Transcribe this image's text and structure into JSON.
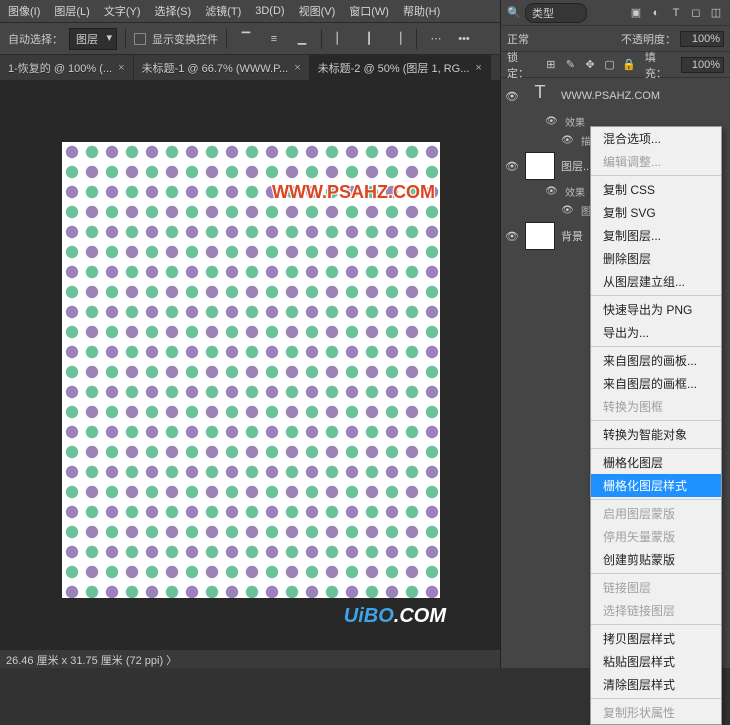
{
  "menu": [
    "图像(I)",
    "图层(L)",
    "文字(Y)",
    "选择(S)",
    "滤镜(T)",
    "3D(D)",
    "视图(V)",
    "窗口(W)",
    "帮助(H)"
  ],
  "toolbar": {
    "auto_select": "自动选择：",
    "layer_dd": "图层",
    "show_transform": "显示变换控件"
  },
  "tabs": [
    {
      "label": "1-恢复的 @ 100% (...",
      "active": false
    },
    {
      "label": "未标题-1 @ 66.7% (WWW.P...",
      "active": false
    },
    {
      "label": "未标题-2 @ 50% (图层 1, RG...",
      "active": true
    }
  ],
  "canvas": {
    "watermark": "WWW.PSAHZ.COM",
    "brand": "UiBO"
  },
  "status": "26.46 厘米 x 31.75 厘米 (72 ppi)  〉",
  "panel": {
    "search_prefix": "类型",
    "blend": "正常",
    "opacity_label": "不透明度：",
    "opacity_val": "100%",
    "lock_label": "锁定：",
    "fill_label": "填充：",
    "fill_val": "100%",
    "layers": [
      {
        "type": "text",
        "name": "WWW.PSAHZ.COM"
      },
      {
        "type": "fx",
        "name": "效果"
      },
      {
        "type": "sub",
        "name": "描..."
      },
      {
        "type": "normal",
        "name": "图层..."
      },
      {
        "type": "fx",
        "name": "效果"
      },
      {
        "type": "sub",
        "name": "图..."
      },
      {
        "type": "normal",
        "name": "背景"
      }
    ]
  },
  "ctx": {
    "items": [
      {
        "t": "混合选项...",
        "d": false
      },
      {
        "t": "编辑调整...",
        "d": true
      },
      {
        "sep": true
      },
      {
        "t": "复制 CSS",
        "d": false
      },
      {
        "t": "复制 SVG",
        "d": false
      },
      {
        "t": "复制图层...",
        "d": false
      },
      {
        "t": "删除图层",
        "d": false
      },
      {
        "t": "从图层建立组...",
        "d": false
      },
      {
        "sep": true
      },
      {
        "t": "快速导出为 PNG",
        "d": false
      },
      {
        "t": "导出为...",
        "d": false
      },
      {
        "sep": true
      },
      {
        "t": "来自图层的画板...",
        "d": false
      },
      {
        "t": "来自图层的画框...",
        "d": false
      },
      {
        "t": "转换为图框",
        "d": true
      },
      {
        "sep": true
      },
      {
        "t": "转换为智能对象",
        "d": false
      },
      {
        "sep": true
      },
      {
        "t": "栅格化图层",
        "d": false
      },
      {
        "t": "栅格化图层样式",
        "sel": true
      },
      {
        "sep": true
      },
      {
        "t": "启用图层蒙版",
        "d": true
      },
      {
        "t": "停用矢量蒙版",
        "d": true
      },
      {
        "t": "创建剪贴蒙版",
        "d": false
      },
      {
        "sep": true
      },
      {
        "t": "链接图层",
        "d": true
      },
      {
        "t": "选择链接图层",
        "d": true
      },
      {
        "sep": true
      },
      {
        "t": "拷贝图层样式",
        "d": false
      },
      {
        "t": "粘贴图层样式",
        "d": false
      },
      {
        "t": "清除图层样式",
        "d": false
      },
      {
        "sep": true
      },
      {
        "t": "复制形状属性",
        "d": true
      }
    ]
  }
}
